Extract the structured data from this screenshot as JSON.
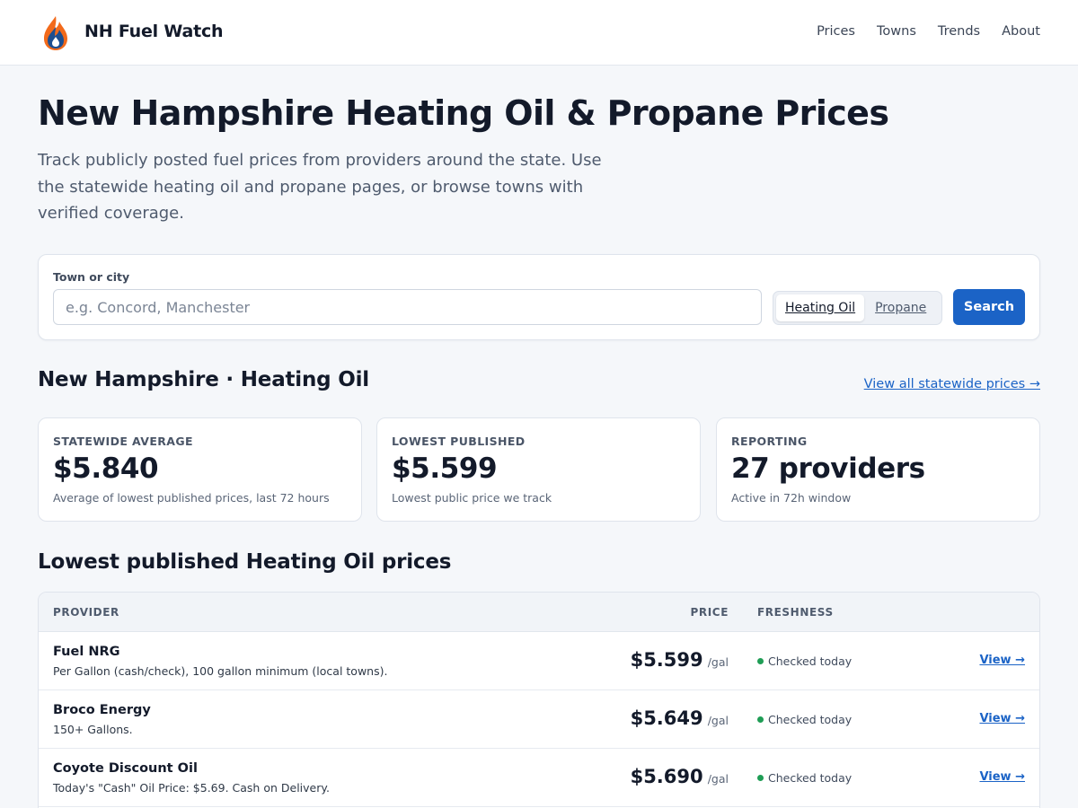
{
  "header": {
    "brand": "NH Fuel Watch",
    "logo_icon": "flame-drop-icon",
    "nav": [
      {
        "label": "Prices"
      },
      {
        "label": "Towns"
      },
      {
        "label": "Trends"
      },
      {
        "label": "About"
      }
    ]
  },
  "hero": {
    "title": "New Hampshire Heating Oil & Propane Prices",
    "subtitle": "Track publicly posted fuel prices from providers around the state. Use the statewide heating oil and propane pages, or browse towns with verified coverage."
  },
  "search": {
    "label": "Town or city",
    "placeholder": "e.g. Concord, Manchester",
    "value": "",
    "fuel_options": [
      "Heating Oil",
      "Propane"
    ],
    "selected_fuel": "Heating Oil",
    "button_label": "Search"
  },
  "summary": {
    "title": "New Hampshire · Heating Oil",
    "view_all_label": "View all statewide prices →",
    "stats": [
      {
        "label": "Statewide average",
        "value": "$5.840",
        "note": "Average of lowest published prices, last 72 hours"
      },
      {
        "label": "Lowest published",
        "value": "$5.599",
        "note": "Lowest public price we track"
      },
      {
        "label": "Reporting",
        "value": "27 providers",
        "note": "Active in 72h window"
      }
    ]
  },
  "table": {
    "title": "Lowest published Heating Oil prices",
    "columns": [
      "PROVIDER",
      "PRICE",
      "FRESHNESS"
    ],
    "rows": [
      {
        "provider": "Fuel NRG",
        "note": "Per Gallon (cash/check), 100 gallon minimum (local towns).",
        "price": "$5.599",
        "unit": "/gal",
        "freshness": "Checked today",
        "action": "View →"
      },
      {
        "provider": "Broco Energy",
        "note": "150+ Gallons.",
        "price": "$5.649",
        "unit": "/gal",
        "freshness": "Checked today",
        "action": "View →"
      },
      {
        "provider": "Coyote Discount Oil",
        "note": "Today's \"Cash\" Oil Price: $5.69. Cash on Delivery.",
        "price": "$5.690",
        "unit": "/gal",
        "freshness": "Checked today",
        "action": "View →"
      }
    ]
  },
  "colors": {
    "accent": "#1b63c6",
    "fresh_status": "#1f9d55",
    "background": "#f5f7fa"
  }
}
